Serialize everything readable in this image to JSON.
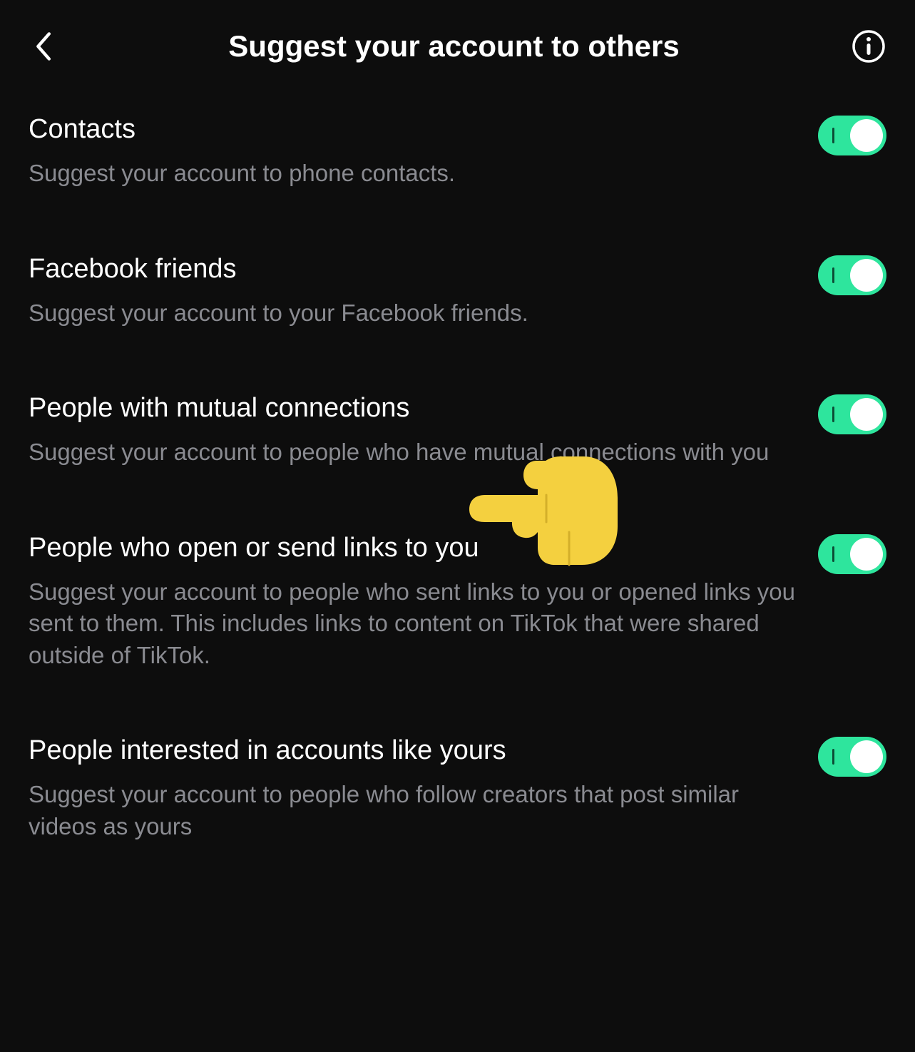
{
  "header": {
    "title": "Suggest your account to others"
  },
  "settings": [
    {
      "title": "Contacts",
      "desc": "Suggest your account to phone contacts.",
      "on": true
    },
    {
      "title": "Facebook friends",
      "desc": "Suggest your account to your Facebook friends.",
      "on": true
    },
    {
      "title": "People with mutual connections",
      "desc": "Suggest your account to people who have mutual connections with you",
      "on": true
    },
    {
      "title": "People who open or send links to you",
      "desc": "Suggest your account to people who sent links to you or opened links you sent to them. This includes links to content on TikTok that were shared outside of TikTok.",
      "on": true
    },
    {
      "title": "People interested in accounts like yours",
      "desc": "Suggest your account to people who follow creators that post similar videos as yours",
      "on": true
    }
  ]
}
